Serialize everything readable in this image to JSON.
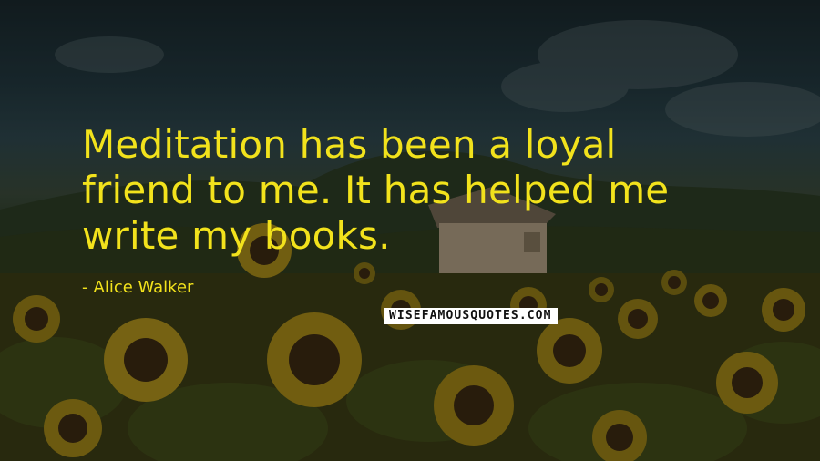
{
  "quote": {
    "line1": "Meditation has been a loyal",
    "line2": "friend to me. It has helped me",
    "line3": "write my books."
  },
  "author": {
    "dash": "-",
    "name": "Alice Walker"
  },
  "watermark": {
    "text": "WISEFAMOUSQUOTES.COM"
  },
  "colors": {
    "quote_text": "#f2e21c",
    "watermark_bg": "#ffffff",
    "watermark_text": "#111111"
  }
}
